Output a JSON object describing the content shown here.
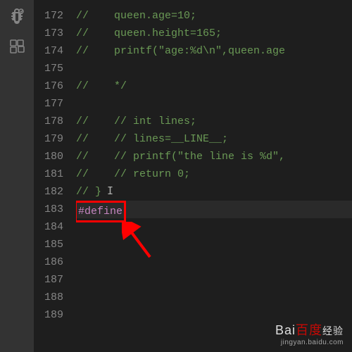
{
  "activity_bar": {
    "icons": [
      "debug",
      "extensions"
    ]
  },
  "editor": {
    "lines": [
      {
        "num": "172",
        "text": "//    queen.age=10;",
        "cls": "comment"
      },
      {
        "num": "173",
        "text": "//    queen.height=165;",
        "cls": "comment"
      },
      {
        "num": "174",
        "text": "//    printf(\"age:%d\\n\",queen.age",
        "cls": "comment"
      },
      {
        "num": "175",
        "text": "",
        "cls": ""
      },
      {
        "num": "176",
        "text": "//    */",
        "cls": "comment"
      },
      {
        "num": "177",
        "text": "",
        "cls": ""
      },
      {
        "num": "178",
        "text": "//    // int lines;",
        "cls": "comment"
      },
      {
        "num": "179",
        "text": "//    // lines=__LINE__;",
        "cls": "comment"
      },
      {
        "num": "180",
        "text": "//    // printf(\"the line is %d\",",
        "cls": "comment"
      },
      {
        "num": "181",
        "text": "//    // return 0;",
        "cls": "comment"
      },
      {
        "num": "182",
        "text": "// }",
        "cls": "comment",
        "cursor_ibeam": true
      },
      {
        "num": "183",
        "text": "#define",
        "cls": "directive",
        "highlight": true,
        "current": true
      },
      {
        "num": "184",
        "text": "",
        "cls": ""
      },
      {
        "num": "185",
        "text": "",
        "cls": ""
      },
      {
        "num": "186",
        "text": "",
        "cls": ""
      },
      {
        "num": "187",
        "text": "",
        "cls": ""
      },
      {
        "num": "188",
        "text": "",
        "cls": ""
      },
      {
        "num": "189",
        "text": "",
        "cls": ""
      }
    ]
  },
  "watermark": {
    "brand_main": "Bai",
    "brand_sub": "百度",
    "brand_tail": "经验",
    "url": "jingyan.baidu.com"
  }
}
